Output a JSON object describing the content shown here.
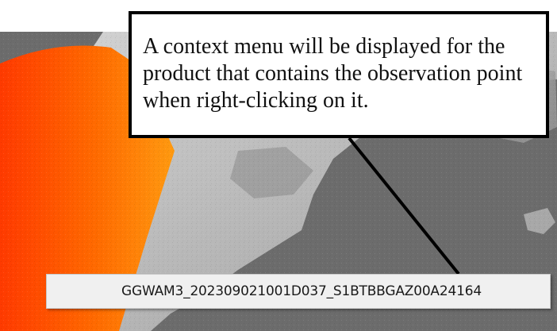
{
  "callout": {
    "text": "A context menu will be displayed for the product that contains the observation point when right-clicking on it."
  },
  "context_menu": {
    "items": [
      {
        "label": "GGWAM3_202309021001D037_S1BTBBGAZ00A24164"
      }
    ]
  },
  "map": {
    "background_color": "#6c6c6c",
    "land_color": "#b8b8b8",
    "swath_colors": [
      "#ff3a00",
      "#ff6a00",
      "#ff9a10"
    ]
  }
}
